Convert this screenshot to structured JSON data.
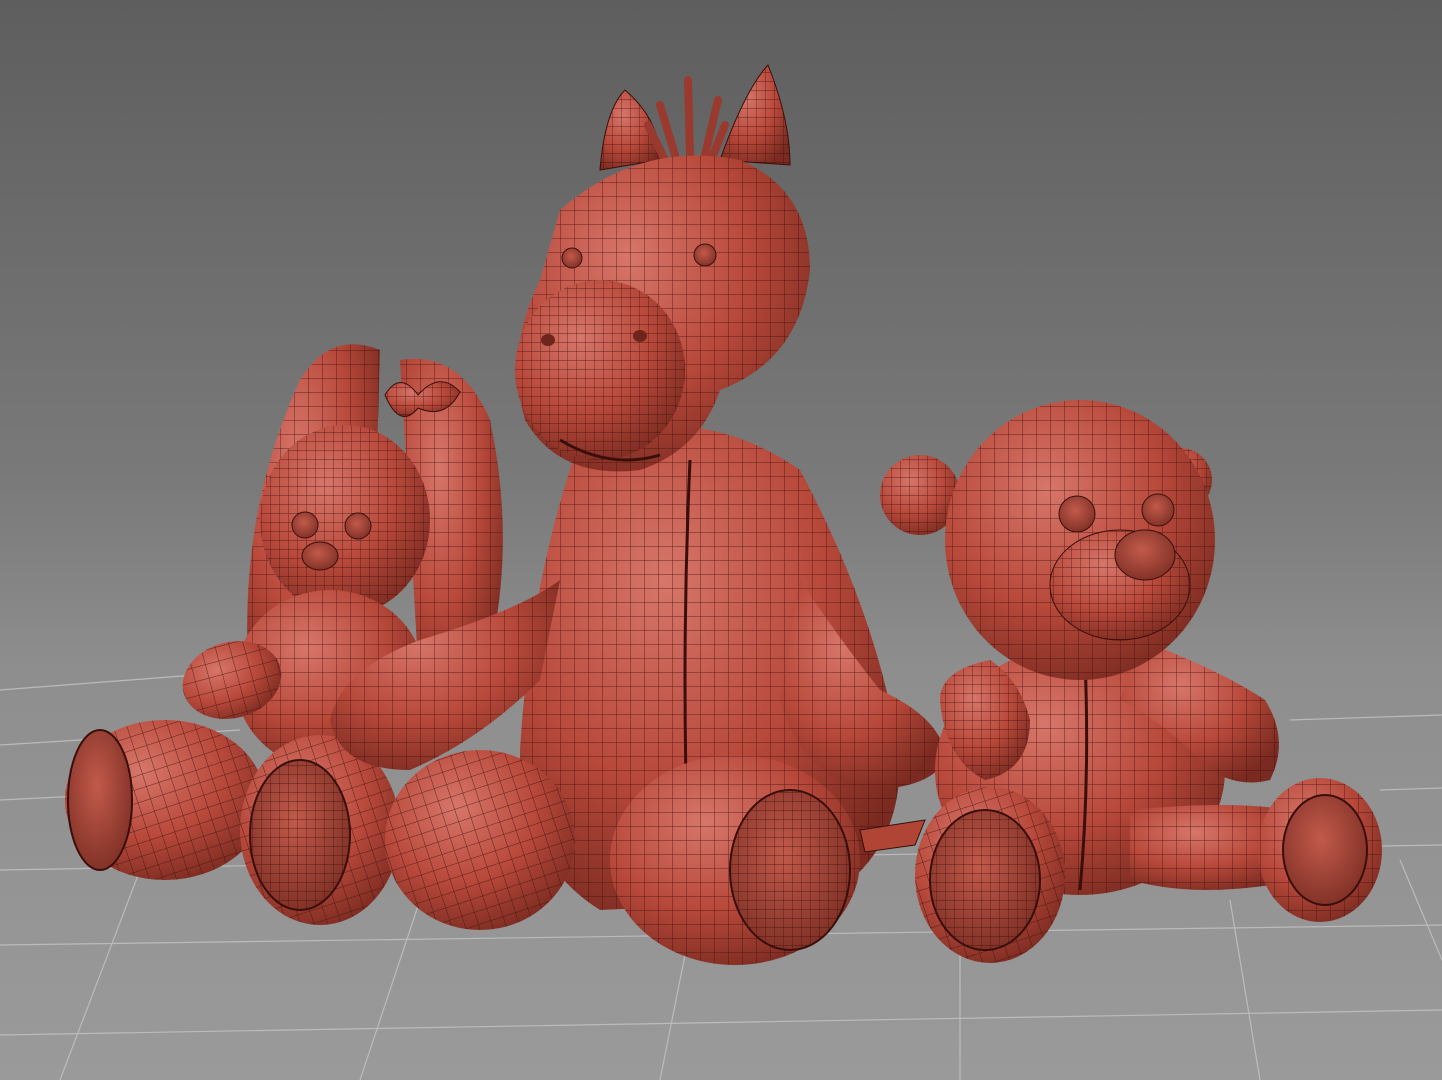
{
  "viewport": {
    "background_top": "#5e5e5e",
    "background_bottom": "#9a9a9a",
    "grid_color": "#c2c2c2",
    "wire_color": "#3a0f0b"
  },
  "materials": {
    "clay_light": "#d06a5a",
    "clay_base": "#b8493b",
    "clay_dark": "#7a2a20"
  },
  "objects": [
    {
      "name": "bunny",
      "shading": "wireframe-on-shaded"
    },
    {
      "name": "horse",
      "shading": "wireframe-on-shaded"
    },
    {
      "name": "bear",
      "shading": "wireframe-on-shaded"
    }
  ]
}
